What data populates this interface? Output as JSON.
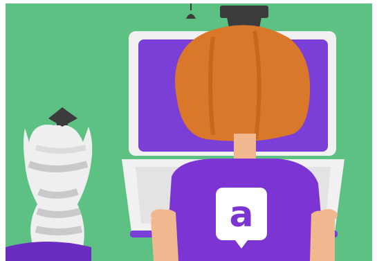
{
  "illustration": {
    "badge_letter": "a",
    "colors": {
      "background": "#5cc183",
      "laptop_shell": "#f1f1f1",
      "laptop_screen": "#7a3fd6",
      "hair": "#d9772a",
      "shirt": "#7c35d3",
      "skin": "#f1b88f",
      "cat_body": "#efefef",
      "cat_stripes": "#c9c9c9",
      "grad_cap": "#3c3c3c",
      "badge": "#ffffff",
      "floor_cushion": "#6b2dbf"
    },
    "icons": [
      "graduation-cap-icon",
      "cat-illustration",
      "laptop-illustration",
      "student-illustration",
      "brand-badge-icon"
    ]
  }
}
